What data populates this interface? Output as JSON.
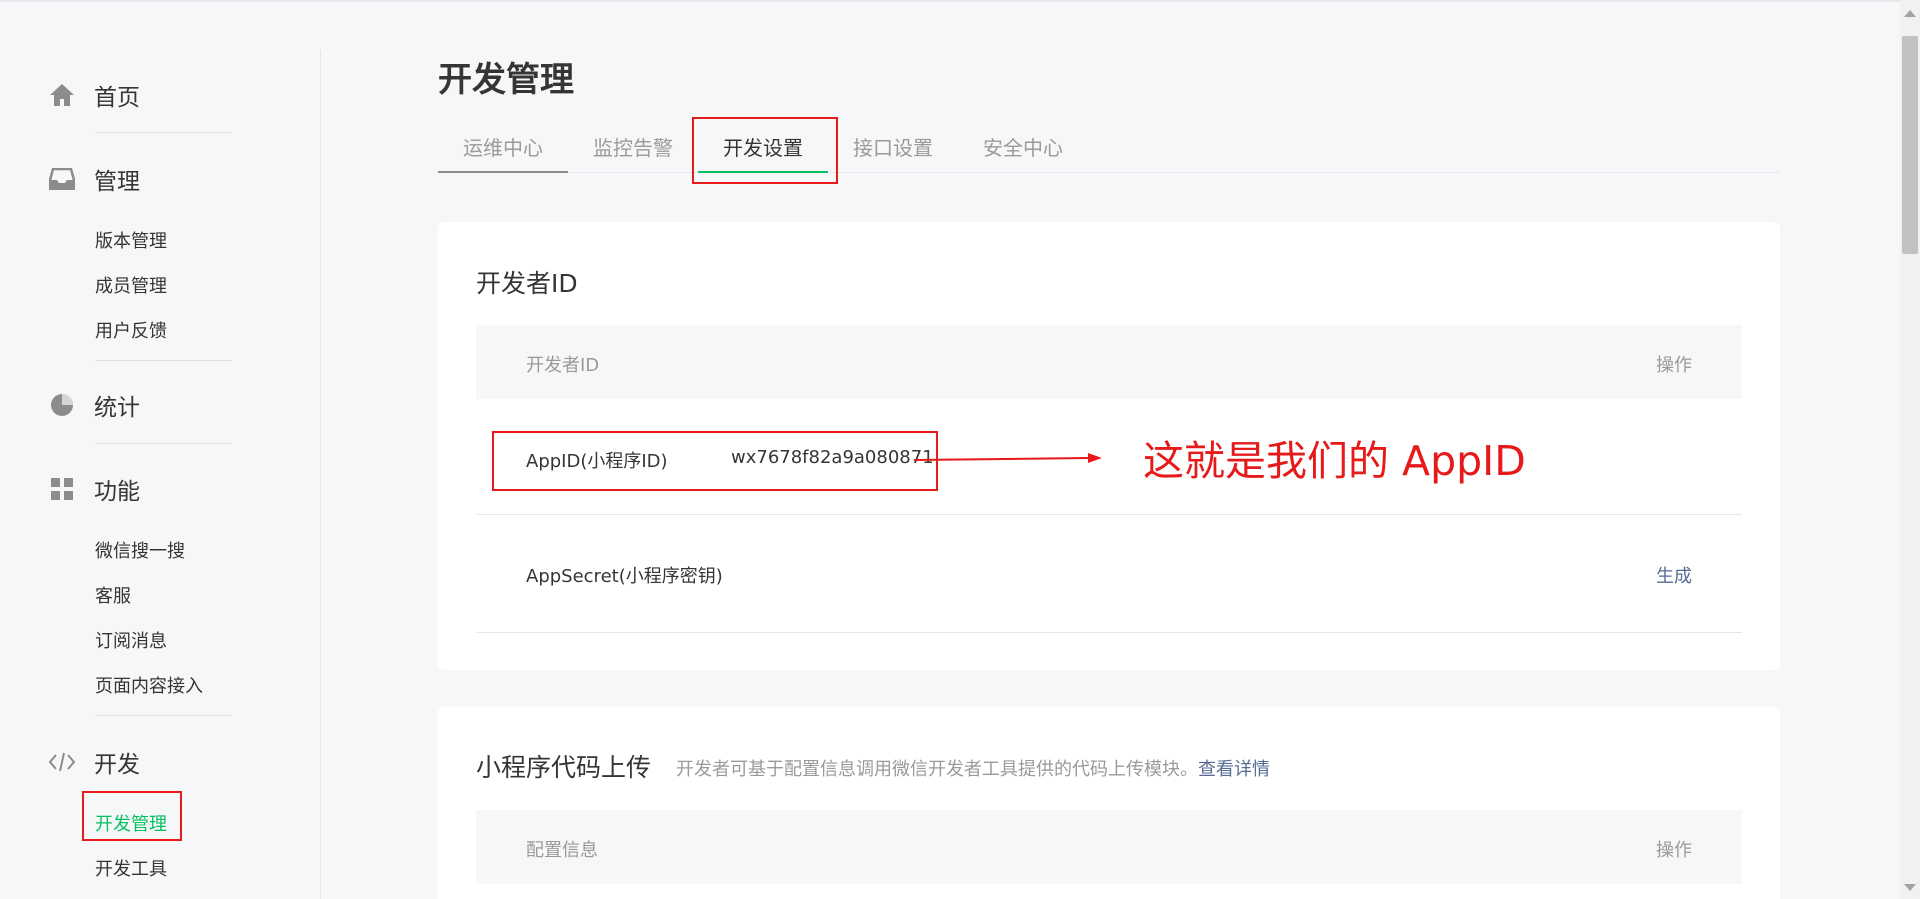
{
  "sidebar": {
    "home": {
      "label": "首页",
      "icon": "home-icon"
    },
    "manage": {
      "label": "管理",
      "icon": "inbox-icon",
      "items": [
        "版本管理",
        "成员管理",
        "用户反馈"
      ]
    },
    "stats": {
      "label": "统计",
      "icon": "pie-chart-icon"
    },
    "features": {
      "label": "功能",
      "icon": "grid-icon",
      "items": [
        "微信搜一搜",
        "客服",
        "订阅消息",
        "页面内容接入"
      ]
    },
    "dev": {
      "label": "开发",
      "icon": "code-icon",
      "items": [
        "开发管理",
        "开发工具"
      ]
    }
  },
  "page": {
    "title": "开发管理"
  },
  "tabs": [
    "运维中心",
    "监控告警",
    "开发设置",
    "接口设置",
    "安全中心"
  ],
  "developer_id": {
    "title": "开发者ID",
    "header": {
      "col1": "开发者ID",
      "col2": "操作"
    },
    "rows": [
      {
        "label": "AppID(小程序ID)",
        "value": "wx7678f82a9a080871",
        "action": ""
      },
      {
        "label": "AppSecret(小程序密钥)",
        "value": "",
        "action": "生成"
      }
    ],
    "annotation": "这就是我们的 AppID"
  },
  "code_upload": {
    "title": "小程序代码上传",
    "description": "开发者可基于配置信息调用微信开发者工具提供的代码上传模块。",
    "detail_link": "查看详情",
    "header": {
      "col1": "配置信息",
      "col2": "操作"
    }
  },
  "colors": {
    "accent": "#07c160",
    "link": "#576b95",
    "annotation": "#e61a1a"
  }
}
